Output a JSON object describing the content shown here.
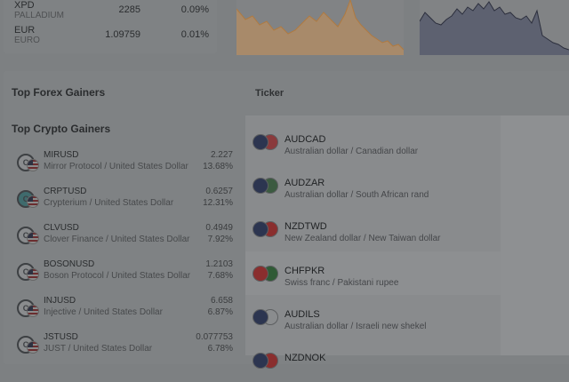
{
  "quotes": [
    {
      "symbol": "XPD",
      "name": "PALLADIUM",
      "value": "2285",
      "change": "0.09%"
    },
    {
      "symbol": "EUR",
      "name": "EURO",
      "value": "1.09759",
      "change": "0.01%"
    }
  ],
  "charts": {
    "orange_fill": "#a88a6a",
    "orange_line": "#b07a40",
    "dark_fill": "#5d6170",
    "dark_line": "#2c2f3d"
  },
  "sections": {
    "forex_title": "Top Forex Gainers",
    "crypto_title": "Top Crypto Gainers",
    "ticker_title": "Ticker"
  },
  "crypto": [
    {
      "symbol": "MIRUSD",
      "name": "Mirror Protocol / United States Dollar",
      "price": "2.227",
      "change": "13.68%",
      "coin": "C",
      "teal": false
    },
    {
      "symbol": "CRPTUSD",
      "name": "Crypterium / United States Dollar",
      "price": "0.6257",
      "change": "12.31%",
      "coin": "C",
      "teal": true
    },
    {
      "symbol": "CLVUSD",
      "name": "Clover Finance / United States Dollar",
      "price": "0.4949",
      "change": "7.92%",
      "coin": "C",
      "teal": false
    },
    {
      "symbol": "BOSONUSD",
      "name": "Boson Protocol / United States Dollar",
      "price": "1.2103",
      "change": "7.68%",
      "coin": "C",
      "teal": false
    },
    {
      "symbol": "INJUSD",
      "name": "Injective / United States Dollar",
      "price": "6.658",
      "change": "6.87%",
      "coin": "C",
      "teal": false
    },
    {
      "symbol": "JSTUSD",
      "name": "JUST / United States Dollar",
      "price": "0.077753",
      "change": "6.78%",
      "coin": "C",
      "teal": false
    }
  ],
  "ticker": [
    {
      "symbol": "AUDCAD",
      "name": "Australian dollar / Canadian dollar",
      "flag_a": "#2c3550",
      "flag_b": "#8a3a3c",
      "highlight": false
    },
    {
      "symbol": "AUDZAR",
      "name": "Australian dollar / South African rand",
      "flag_a": "#2c3550",
      "flag_b": "#3b5a40",
      "highlight": false
    },
    {
      "symbol": "NZDTWD",
      "name": "New Zealand dollar / New Taiwan dollar",
      "flag_a": "#2c3550",
      "flag_b": "#8a2e2e",
      "highlight": false
    },
    {
      "symbol": "CHFPKR",
      "name": "Swiss franc / Pakistani rupee",
      "flag_a": "#8a2e2e",
      "flag_b": "#2f5a35",
      "highlight": true
    },
    {
      "symbol": "AUDILS",
      "name": "Australian dollar / Israeli new shekel",
      "flag_a": "#2c3550",
      "flag_b": "#8a8c8e",
      "highlight": false
    },
    {
      "symbol": "NZDNOK",
      "name": "",
      "flag_a": "#2c3550",
      "flag_b": "#8a2e2e",
      "highlight": false
    }
  ]
}
